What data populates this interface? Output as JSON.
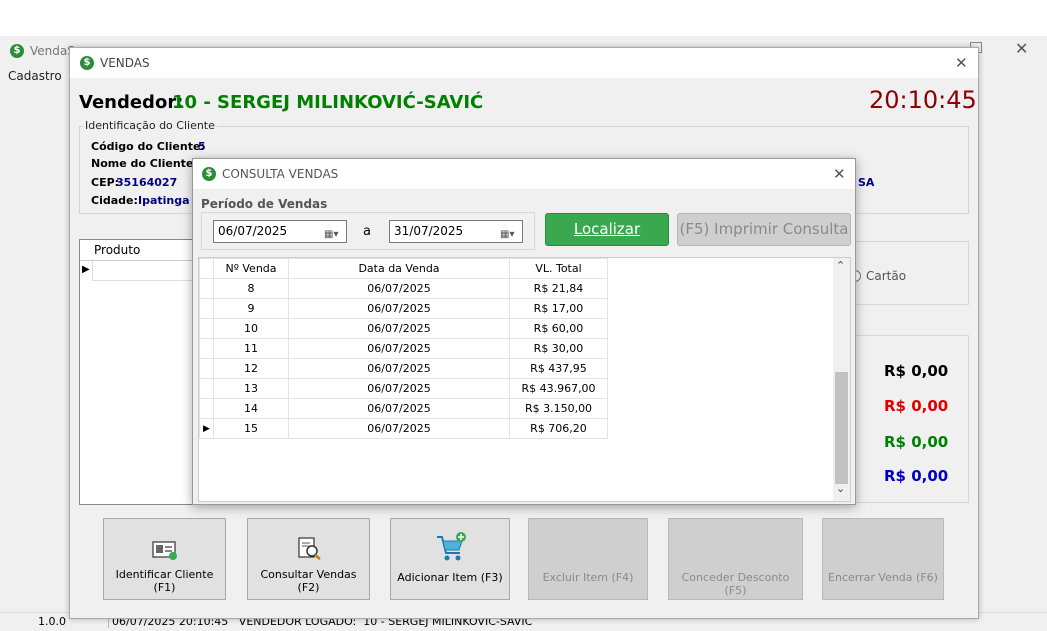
{
  "main_window": {
    "title": "VendaS",
    "menu_cadastro": "Cadastro"
  },
  "vendas": {
    "title": "VENDAS",
    "vendedor_label": "Vendedor:",
    "vendedor_value": "10 - SERGEJ MILINKOVIĆ-SAVIĆ",
    "clock": "20:10:45",
    "cliente_group": "Identificação do Cliente",
    "codigo_label": "Código do Cliente:",
    "codigo_value": "5",
    "nome_label": "Nome do Cliente:",
    "cep_label": "CEP:",
    "cep_value": "35164027",
    "cidade_label": "Cidade:",
    "cidade_value": "Ipatinga",
    "partial_sa": "SA",
    "produto_header": "Produto",
    "cartao_label": "Cartão",
    "totals": [
      {
        "value": "R$ 0,00",
        "color": "#000000"
      },
      {
        "value": "R$ 0,00",
        "color": "#e00000"
      },
      {
        "value": "R$ 0,00",
        "color": "#008000"
      },
      {
        "value": "R$ 0,00",
        "color": "#0000c0"
      }
    ],
    "buttons": {
      "identificar": "Identificar Cliente (F1)",
      "consultar": "Consultar Vendas (F2)",
      "adicionar": "Adicionar Item (F3)",
      "excluir": "Excluir Item (F4)",
      "desconto": "Conceder Desconto (F5)",
      "encerrar": "Encerrar Venda (F6)"
    }
  },
  "consulta": {
    "title": "CONSULTA VENDAS",
    "periodo_label": "Período de Vendas",
    "date_from": "06/07/2025",
    "a_label": "a",
    "date_to": "31/07/2025",
    "localizar": "Localizar",
    "imprimir": "(F5) Imprimir Consulta",
    "columns": [
      "Nº Venda",
      "Data da Venda",
      "VL. Total"
    ],
    "rows": [
      [
        "8",
        "06/07/2025",
        "R$ 21,84"
      ],
      [
        "9",
        "06/07/2025",
        "R$ 17,00"
      ],
      [
        "10",
        "06/07/2025",
        "R$ 60,00"
      ],
      [
        "11",
        "06/07/2025",
        "R$ 30,00"
      ],
      [
        "12",
        "06/07/2025",
        "R$ 437,95"
      ],
      [
        "13",
        "06/07/2025",
        "R$ 43.967,00"
      ],
      [
        "14",
        "06/07/2025",
        "R$ 3.150,00"
      ],
      [
        "15",
        "06/07/2025",
        "R$ 706,20"
      ]
    ],
    "current_row_index": 7
  },
  "status_bar": {
    "version": "1.0.0",
    "info": "06/07/2025 20:10:45   VENDEDOR LOGADO:  10 - SERGEJ MILINKOVIC-SAVIC"
  },
  "colors": {
    "vendedor": "#008000",
    "clock": "#8b0000",
    "localizar_bg": "#3aa84e",
    "navy": "#000080"
  }
}
